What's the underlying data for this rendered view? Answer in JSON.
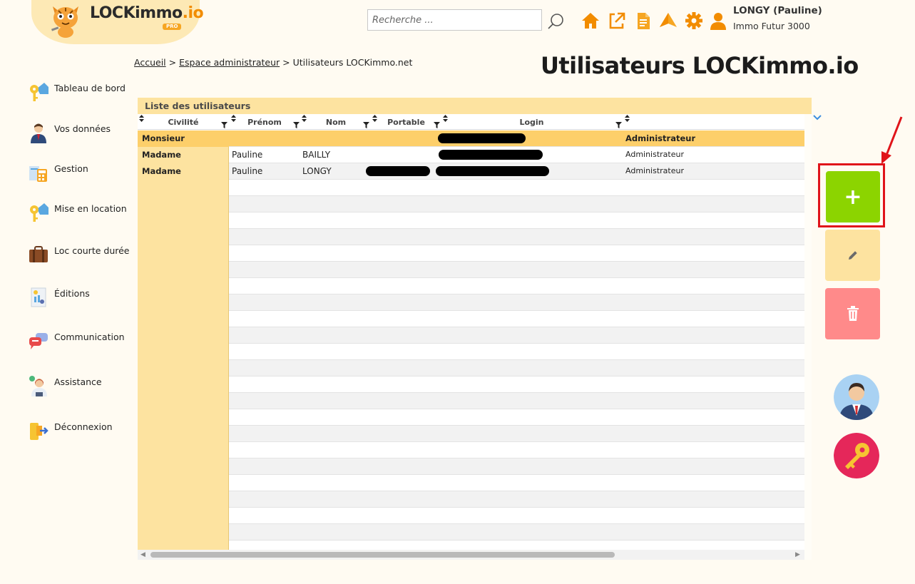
{
  "brand": {
    "name_main": "LOCKimmo",
    "name_suffix": ".io",
    "badge": "PRO"
  },
  "search": {
    "placeholder": "Recherche ..."
  },
  "top_icons": [
    "home-icon",
    "external-link-icon",
    "document-icon",
    "paper-plane-icon",
    "gear-icon",
    "user-icon"
  ],
  "user": {
    "name": "LONGY (Pauline)",
    "company": "Immo Futur 3000"
  },
  "breadcrumb": {
    "home": "Accueil",
    "sep1": ">",
    "admin": "Espace administrateur",
    "sep2": ">",
    "current": "Utilisateurs LOCKimmo.net"
  },
  "page": {
    "title": "Utilisateurs LOCKimmo.io"
  },
  "sidebar": {
    "items": [
      {
        "label": "Tableau de bord",
        "icon": "keys-house-icon"
      },
      {
        "label": "Vos données",
        "icon": "person-icon"
      },
      {
        "label": "Gestion",
        "icon": "calculator-icon"
      },
      {
        "label": "Mise en location",
        "icon": "keys-house-icon"
      },
      {
        "label": "Loc courte durée",
        "icon": "suitcase-icon"
      },
      {
        "label": "Éditions",
        "icon": "report-icon"
      },
      {
        "label": "Communication",
        "icon": "chat-bubbles-icon"
      },
      {
        "label": "Assistance",
        "icon": "support-agent-icon"
      },
      {
        "label": "Déconnexion",
        "icon": "logout-icon"
      }
    ]
  },
  "table": {
    "title": "Liste des utilisateurs",
    "columns": [
      "Civilité",
      "Prénom",
      "Nom",
      "Portable",
      "Login",
      ""
    ],
    "rows": [
      {
        "civilite": "Monsieur",
        "prenom": "",
        "nom": "",
        "portable_redacted": false,
        "login_redacted": true,
        "role": "Administrateur",
        "selected": true
      },
      {
        "civilite": "Madame",
        "prenom": "Pauline",
        "nom": "BAILLY",
        "portable_redacted": false,
        "login_redacted": true,
        "role": "Administrateur",
        "selected": false
      },
      {
        "civilite": "Madame",
        "prenom": "Pauline",
        "nom": "LONGY",
        "portable_redacted": true,
        "login_redacted": true,
        "role": "Administrateur",
        "selected": false
      }
    ]
  },
  "actions": {
    "add_label": "+"
  },
  "colors": {
    "accent": "#f28c00",
    "panel": "#fde3a0",
    "selected_row": "#fdcf6a",
    "add": "#8cd400",
    "delete": "#ff8a8a",
    "highlight": "#e0141a"
  }
}
